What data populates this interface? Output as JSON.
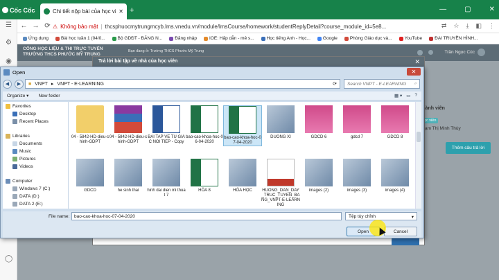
{
  "browser": {
    "brand": "Cốc Cốc",
    "tab_title": "Chi tiết nộp bài của học viên",
    "security_label": "Không bảo mật",
    "url": "thcsphuocmytrungmcyb.lms.vnedu.vn/module/lmsCourse/homework/studentReplyDetail?course_module_id=5e8...",
    "bookmarks": [
      "Ứng dụng",
      "Bài học tuần 1 (04/0...",
      "Bộ GDĐT - ĐĂNG N...",
      "Đăng nhập",
      "IOE: Hấp dẫn - mê s...",
      "Học tiếng Anh - Học...",
      "Google",
      "Phòng Giáo dục và...",
      "YouTube",
      "ĐẠI TRUYỀN HÌNH..."
    ]
  },
  "site": {
    "org_line1": "CỔNG HỌC LIỆU & THI TRỰC TUYẾN",
    "org_line2": "TRƯỜNG THCS PHƯỚC MỸ TRUNG",
    "crumb": "Bạn đang ở: Trường THCS Phước Mỹ Trung",
    "user_name": "Trần Ngọc Cúc",
    "member_section": "Thành viên",
    "member_role": "Học viên",
    "member_name": "Phạm Thị Minh Thùy",
    "add_answer": "Thêm câu trả lời",
    "modal_title": "Trả lời bài tập về nhà của học viên",
    "modal_button": ""
  },
  "dialog": {
    "title": "Open",
    "path_root": "VNPT",
    "path_sep": "▸",
    "path_folder": "VNPT - E-LEARNING",
    "search_placeholder": "Search VNPT - E-LEARNING",
    "organize": "Organize ▾",
    "new_folder": "New folder",
    "nav": {
      "favorites": "Favorites",
      "desktop": "Desktop",
      "recent": "Recent Places",
      "libraries": "Libraries",
      "documents": "Documents",
      "music": "Music",
      "pictures": "Pictures",
      "videos": "Videos",
      "computer": "Computer",
      "drive_c": "Windows 7 (C:)",
      "drive_d": "DATA (D:)",
      "drive_e": "DATA 2 (E:)"
    },
    "files": [
      {
        "name": "04 - 5842-HD-dieu-chinh-GDPT",
        "kind": "folder"
      },
      {
        "name": "04 - 5842-HD-dieu-chinh-GDPT",
        "kind": "rar"
      },
      {
        "name": "BAI TAP VE TU GIAC NOI TIEP - Copy",
        "kind": "word"
      },
      {
        "name": "bao-cao-khoa-hoc-06-04-2020",
        "kind": "excel"
      },
      {
        "name": "bao-cao-khoa-hoc-07-04-2020",
        "kind": "excel",
        "selected": true
      },
      {
        "name": "DUONG XI",
        "kind": "image"
      },
      {
        "name": "GDCD 6",
        "kind": "book"
      },
      {
        "name": "gdcd 7",
        "kind": "book"
      },
      {
        "name": "GDCD 8",
        "kind": "book"
      },
      {
        "name": "GDCD",
        "kind": "image"
      },
      {
        "name": "he sinh thai",
        "kind": "image"
      },
      {
        "name": "hinh dai dien mi thuat 7",
        "kind": "image"
      },
      {
        "name": "HÓA 8",
        "kind": "excel"
      },
      {
        "name": "HÓA HỌC",
        "kind": "image"
      },
      {
        "name": "HUONG_DAN_DAY_TRUC_TUYEN_BANG_VNPT-E-LEARNING",
        "kind": "pdf"
      },
      {
        "name": "images (2)",
        "kind": "image"
      },
      {
        "name": "images (3)",
        "kind": "image"
      },
      {
        "name": "images (4)",
        "kind": "image"
      }
    ],
    "filename_label": "File name:",
    "filename_value": "bao-cao-khoa-hoc-07-04-2020",
    "filetype": "Tệp tùy chỉnh",
    "open_label": "Open",
    "cancel_label": "Cancel"
  }
}
